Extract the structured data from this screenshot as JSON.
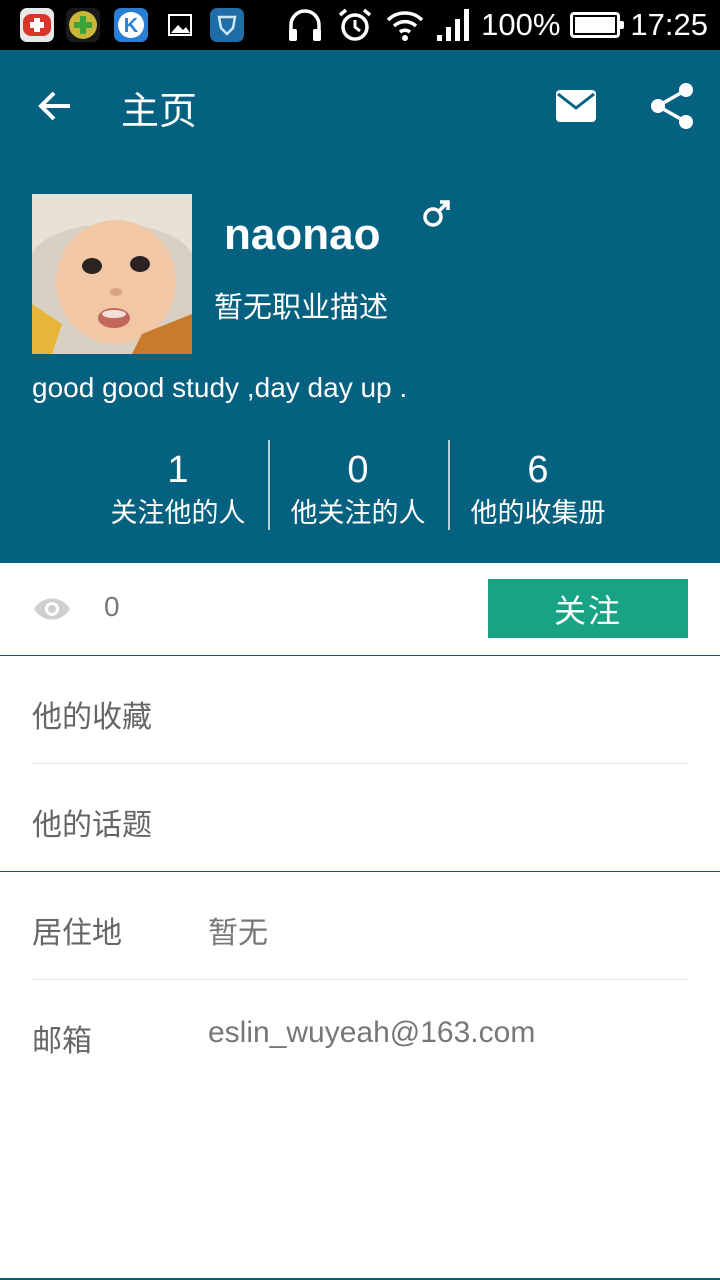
{
  "status_bar": {
    "battery": "100%",
    "time": "17:25",
    "battery_level": 1.0,
    "app_icons": [
      "plus-badge-icon",
      "green-cross-app-icon",
      "k-app-icon",
      "gallery-icon",
      "shield-app-icon"
    ],
    "indicator_icons": [
      "headphones-icon",
      "alarm-icon",
      "wifi-icon",
      "signal-icon"
    ]
  },
  "toolbar": {
    "title": "主页"
  },
  "profile": {
    "username": "naonao",
    "gender": "male",
    "job": "暂无职业描述",
    "bio": "good good study ,day day up ."
  },
  "stats": [
    {
      "value": "1",
      "label": "关注他的人"
    },
    {
      "value": "0",
      "label": "他关注的人"
    },
    {
      "value": "6",
      "label": "他的收集册"
    }
  ],
  "actions": {
    "view_count": "0",
    "follow_label": "关注"
  },
  "links": {
    "favorites": "他的收藏",
    "topics": "他的话题"
  },
  "info": {
    "location_label": "居住地",
    "location_value": "暂无",
    "email_label": "邮箱",
    "email_value": "eslin_wuyeah@163.com"
  },
  "colors": {
    "header": "#04617f",
    "follow_button": "#19a385",
    "status_bar": "#000000"
  }
}
